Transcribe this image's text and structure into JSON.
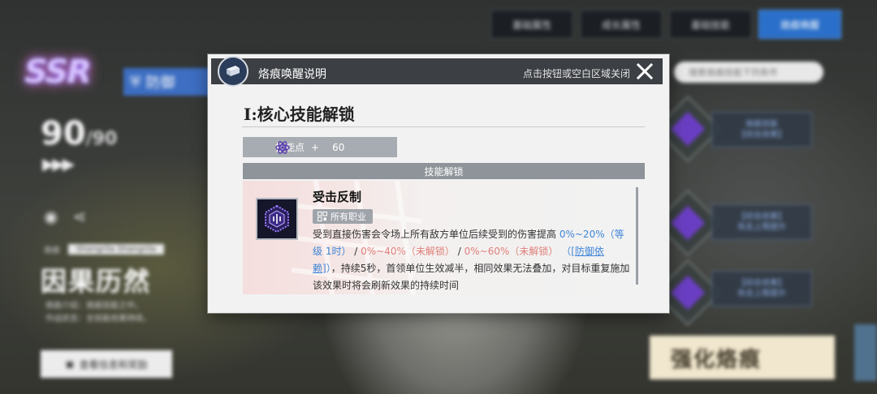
{
  "background": {
    "tabs": [
      {
        "label": "基础属性",
        "active": false
      },
      {
        "label": "成长属性",
        "active": false
      },
      {
        "label": "基础技能",
        "active": false
      },
      {
        "label": "烙痕唤醒",
        "active": true
      }
    ],
    "rarity": "SSR",
    "role_label": "防御",
    "level_current": "90",
    "level_max": "/90",
    "stars": "▶▶▶",
    "name_tag_label": "烙痕",
    "name_tag_value": "Shangrila Shangrila",
    "character_name": "因果历然",
    "desc_line_1": "烙痕介绍：烙痕技能之中。",
    "desc_line_2": "作战状态：全技能效果持续。",
    "view_details_button": "查看信息和奖励",
    "search_placeholder": "搜索烙痕技能下列条件",
    "right_cards": [
      "烙痕技能\n【综合效果】",
      "【综合效果】\n攻击上限提升",
      "【综合效果】\n攻击上限提升"
    ],
    "strengthen_button": "强化烙痕",
    "colors": {
      "active_tab": "#2a6fc9",
      "role_badge": "#3d6ec2"
    }
  },
  "modal": {
    "title": "烙痕唤醒说明",
    "close_hint": "点击按钮或空白区域关闭",
    "close_icon": "close-x-icon",
    "section_title": "I:核心技能解锁",
    "skill_points_label": "技能点",
    "skill_points_plus": "+",
    "skill_points_value": "60",
    "unlock_header": "技能解锁",
    "skill": {
      "name": "受击反制",
      "job_tag": "所有职业",
      "desc_part1": "受到直接伤害会令场上所有敌方单位后续受到的伤害提高",
      "range1": "0%~20%（等级 1时）",
      "sep1": "/",
      "range2": "0%~40%（未解锁）",
      "sep2": "/",
      "range3": "0%~60%（未解锁）",
      "paren_open": "（",
      "link": "[防御依赖]",
      "paren_close": "）",
      "desc_part2": "，持续5秒，首领单位生效减半，相同效果无法叠加，对目标重复施加该效果时将会刷新效果的持续时间"
    },
    "colors": {
      "highlight_blue": "#3f86d9",
      "locked_red": "#e0807a",
      "header_dark": "#3c3f44"
    }
  }
}
